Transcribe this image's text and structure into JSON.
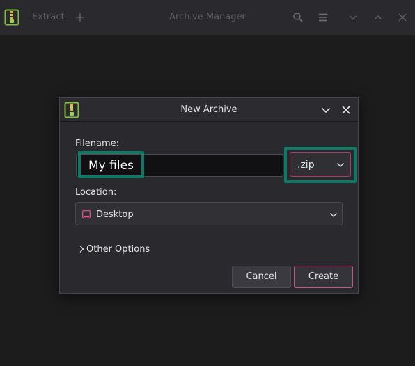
{
  "window": {
    "title": "Archive Manager",
    "extract_label": "Extract",
    "icons": [
      "archive-app-icon",
      "add-icon",
      "search-icon",
      "hamburger-menu-icon",
      "chevron-down-icon",
      "chevron-up-icon",
      "close-icon"
    ]
  },
  "dialog": {
    "title": "New Archive",
    "filename_label": "Filename:",
    "filename_value": "My files",
    "format_value": ".zip",
    "location_label": "Location:",
    "location_value": "Desktop",
    "other_options_label": "Other Options",
    "cancel_label": "Cancel",
    "create_label": "Create"
  },
  "colors": {
    "highlight": "#0c7a64",
    "accent": "#d94a8a",
    "background": "#1c1c1c",
    "surface": "#2a2a2e"
  }
}
